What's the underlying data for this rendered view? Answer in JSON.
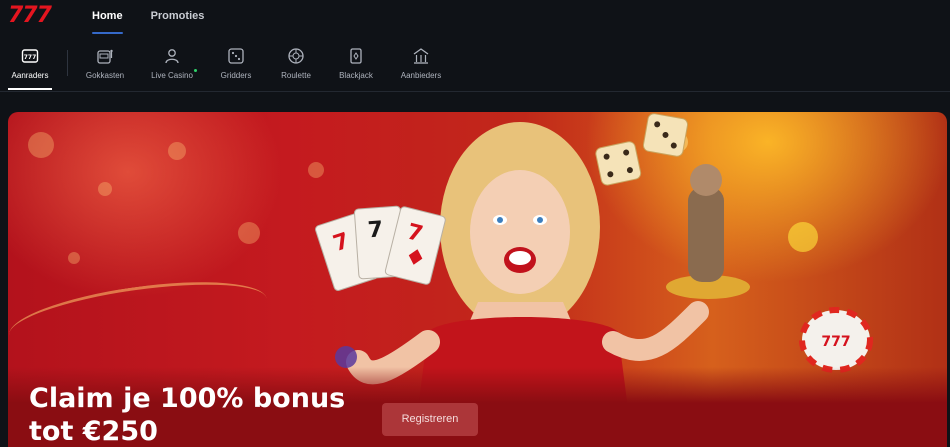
{
  "header": {
    "logo": "777",
    "nav": [
      {
        "label": "Home",
        "active": true
      },
      {
        "label": "Promoties",
        "active": false
      }
    ]
  },
  "categories": [
    {
      "label": "Aanraders",
      "icon": "777-icon",
      "active": true
    },
    {
      "label": "Gokkasten",
      "icon": "slot-machine-icon",
      "active": false
    },
    {
      "label": "Live Casino",
      "icon": "dealer-icon",
      "active": false,
      "live_indicator": true
    },
    {
      "label": "Gridders",
      "icon": "dice-icon",
      "active": false
    },
    {
      "label": "Roulette",
      "icon": "roulette-icon",
      "active": false
    },
    {
      "label": "Blackjack",
      "icon": "card-icon",
      "active": false
    },
    {
      "label": "Aanbieders",
      "icon": "building-icon",
      "active": false
    }
  ],
  "banner": {
    "headline_line1": "Claim je 100% bonus",
    "headline_line2": "tot €250",
    "cta_label": "Registreren"
  },
  "colors": {
    "brand": "#e4151f",
    "accent": "#3569c9",
    "background": "#0f1217",
    "live": "#2fd36b"
  }
}
